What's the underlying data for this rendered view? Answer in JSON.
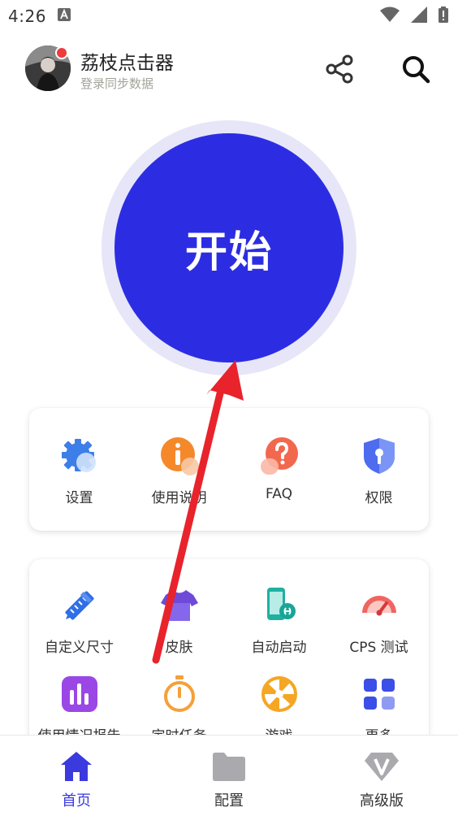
{
  "status_bar": {
    "time": "4:26"
  },
  "header": {
    "title": "荔枝点击器",
    "subtitle": "登录同步数据"
  },
  "start_button": {
    "label": "开始",
    "color": "#2c2de3"
  },
  "quick_menu": [
    {
      "label": "设置",
      "icon": "gear-icon"
    },
    {
      "label": "使用说明",
      "icon": "info-icon"
    },
    {
      "label": "FAQ",
      "icon": "question-icon"
    },
    {
      "label": "权限",
      "icon": "shield-lock-icon"
    }
  ],
  "feature_menu": [
    {
      "label": "自定义尺寸",
      "icon": "ruler-pencil-icon"
    },
    {
      "label": "皮肤",
      "icon": "tshirt-icon"
    },
    {
      "label": "自动启动",
      "icon": "phone-link-icon"
    },
    {
      "label": "CPS 测试",
      "icon": "speedometer-icon"
    },
    {
      "label": "使用情况报告",
      "icon": "bar-chart-icon"
    },
    {
      "label": "定时任务",
      "icon": "stopwatch-icon"
    },
    {
      "label": "游戏",
      "icon": "wheel-icon"
    },
    {
      "label": "更多",
      "icon": "grid-icon"
    }
  ],
  "bottom_nav": [
    {
      "label": "首页",
      "icon": "home-icon",
      "active": true
    },
    {
      "label": "配置",
      "icon": "folder-icon",
      "active": false
    },
    {
      "label": "高级版",
      "icon": "diamond-v-icon",
      "active": false
    }
  ],
  "colors": {
    "accent": "#3a3adf",
    "annotation_arrow": "#e8232c"
  }
}
